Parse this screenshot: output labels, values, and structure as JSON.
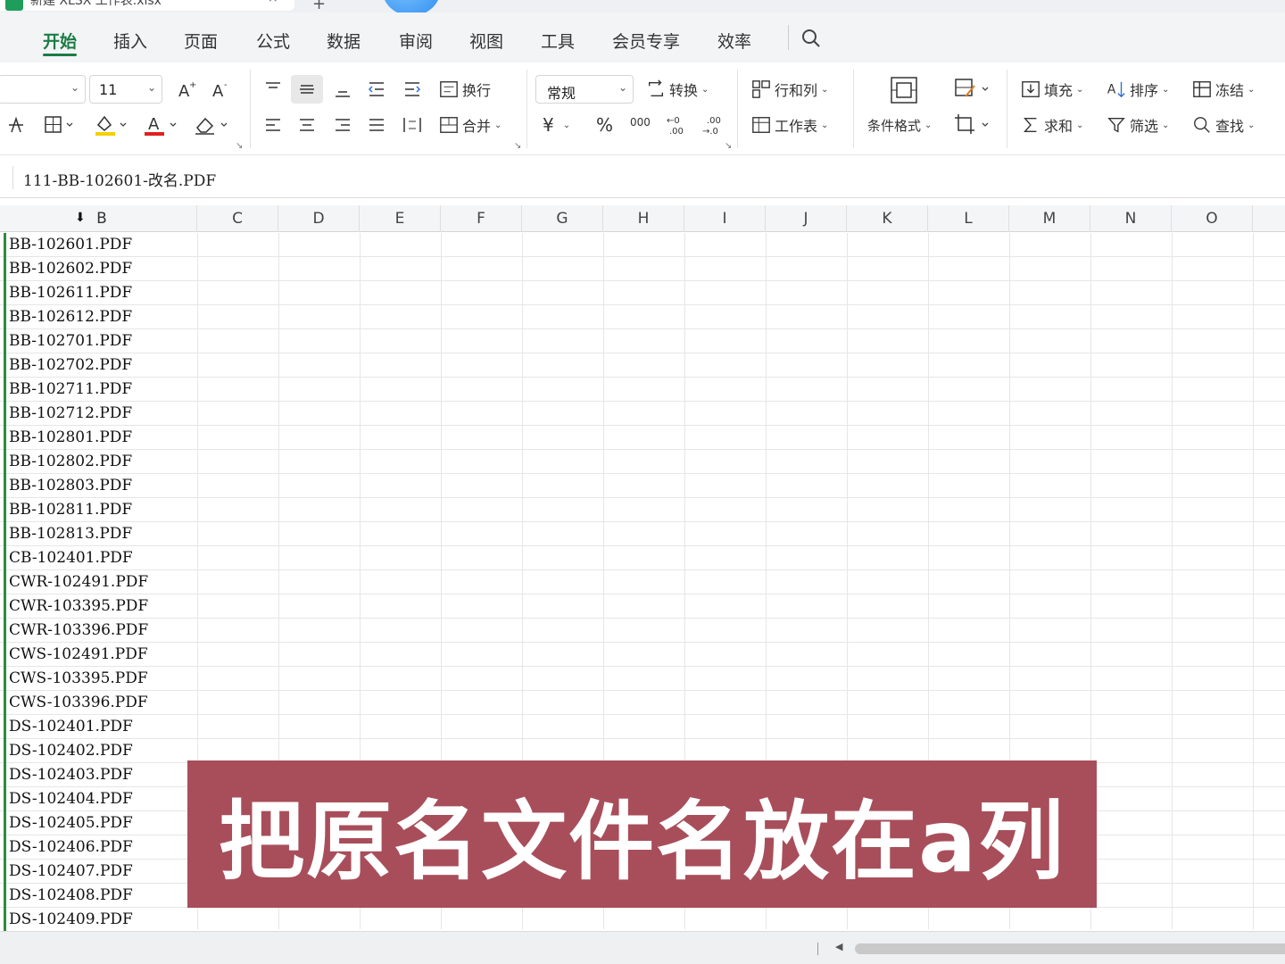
{
  "window": {
    "tab_title": "新建 XLSX 工作表.xlsx",
    "tab_close": "×",
    "new_tab": "+"
  },
  "menu": {
    "items": [
      "开始",
      "插入",
      "页面",
      "公式",
      "数据",
      "审阅",
      "视图",
      "工具",
      "会员专享",
      "效率"
    ],
    "active": "开始"
  },
  "ribbon": {
    "font_size": "11",
    "number_format": "常规",
    "wrap_label": "换行",
    "merge_label": "合并",
    "convert_label": "转换",
    "rows_cols_label": "行和列",
    "worksheet_label": "工作表",
    "cond_format_label": "条件格式",
    "fill_label": "填充",
    "sort_label": "排序",
    "freeze_label": "冻结",
    "sum_label": "求和",
    "filter_label": "筛选",
    "find_label": "查找",
    "currency_symbol": "¥",
    "percent_symbol": "%",
    "thousands_symbol": "000",
    "accent_color": "#1b7c45",
    "font_color_bar": "#e02020",
    "highlight_bar": "#f5d000"
  },
  "formula_bar": {
    "content": "111-BB-102601-改名.PDF"
  },
  "columns": [
    "B",
    "C",
    "D",
    "E",
    "F",
    "G",
    "H",
    "I",
    "J",
    "K",
    "L",
    "M",
    "N",
    "O"
  ],
  "rows": [
    "BB-102601.PDF",
    "BB-102602.PDF",
    "BB-102611.PDF",
    "BB-102612.PDF",
    "BB-102701.PDF",
    "BB-102702.PDF",
    "BB-102711.PDF",
    "BB-102712.PDF",
    "BB-102801.PDF",
    "BB-102802.PDF",
    "BB-102803.PDF",
    "BB-102811.PDF",
    "BB-102813.PDF",
    "CB-102401.PDF",
    "CWR-102491.PDF",
    "CWR-103395.PDF",
    "CWR-103396.PDF",
    "CWS-102491.PDF",
    "CWS-103395.PDF",
    "CWS-103396.PDF",
    "DS-102401.PDF",
    "DS-102402.PDF",
    "DS-102403.PDF",
    "DS-102404.PDF",
    "DS-102405.PDF",
    "DS-102406.PDF",
    "DS-102407.PDF",
    "DS-102408.PDF",
    "DS-102409.PDF"
  ],
  "caption": {
    "text": "把原名文件名放在a列",
    "background": "#a84e5a"
  },
  "selection_color": "#2e8b3c"
}
